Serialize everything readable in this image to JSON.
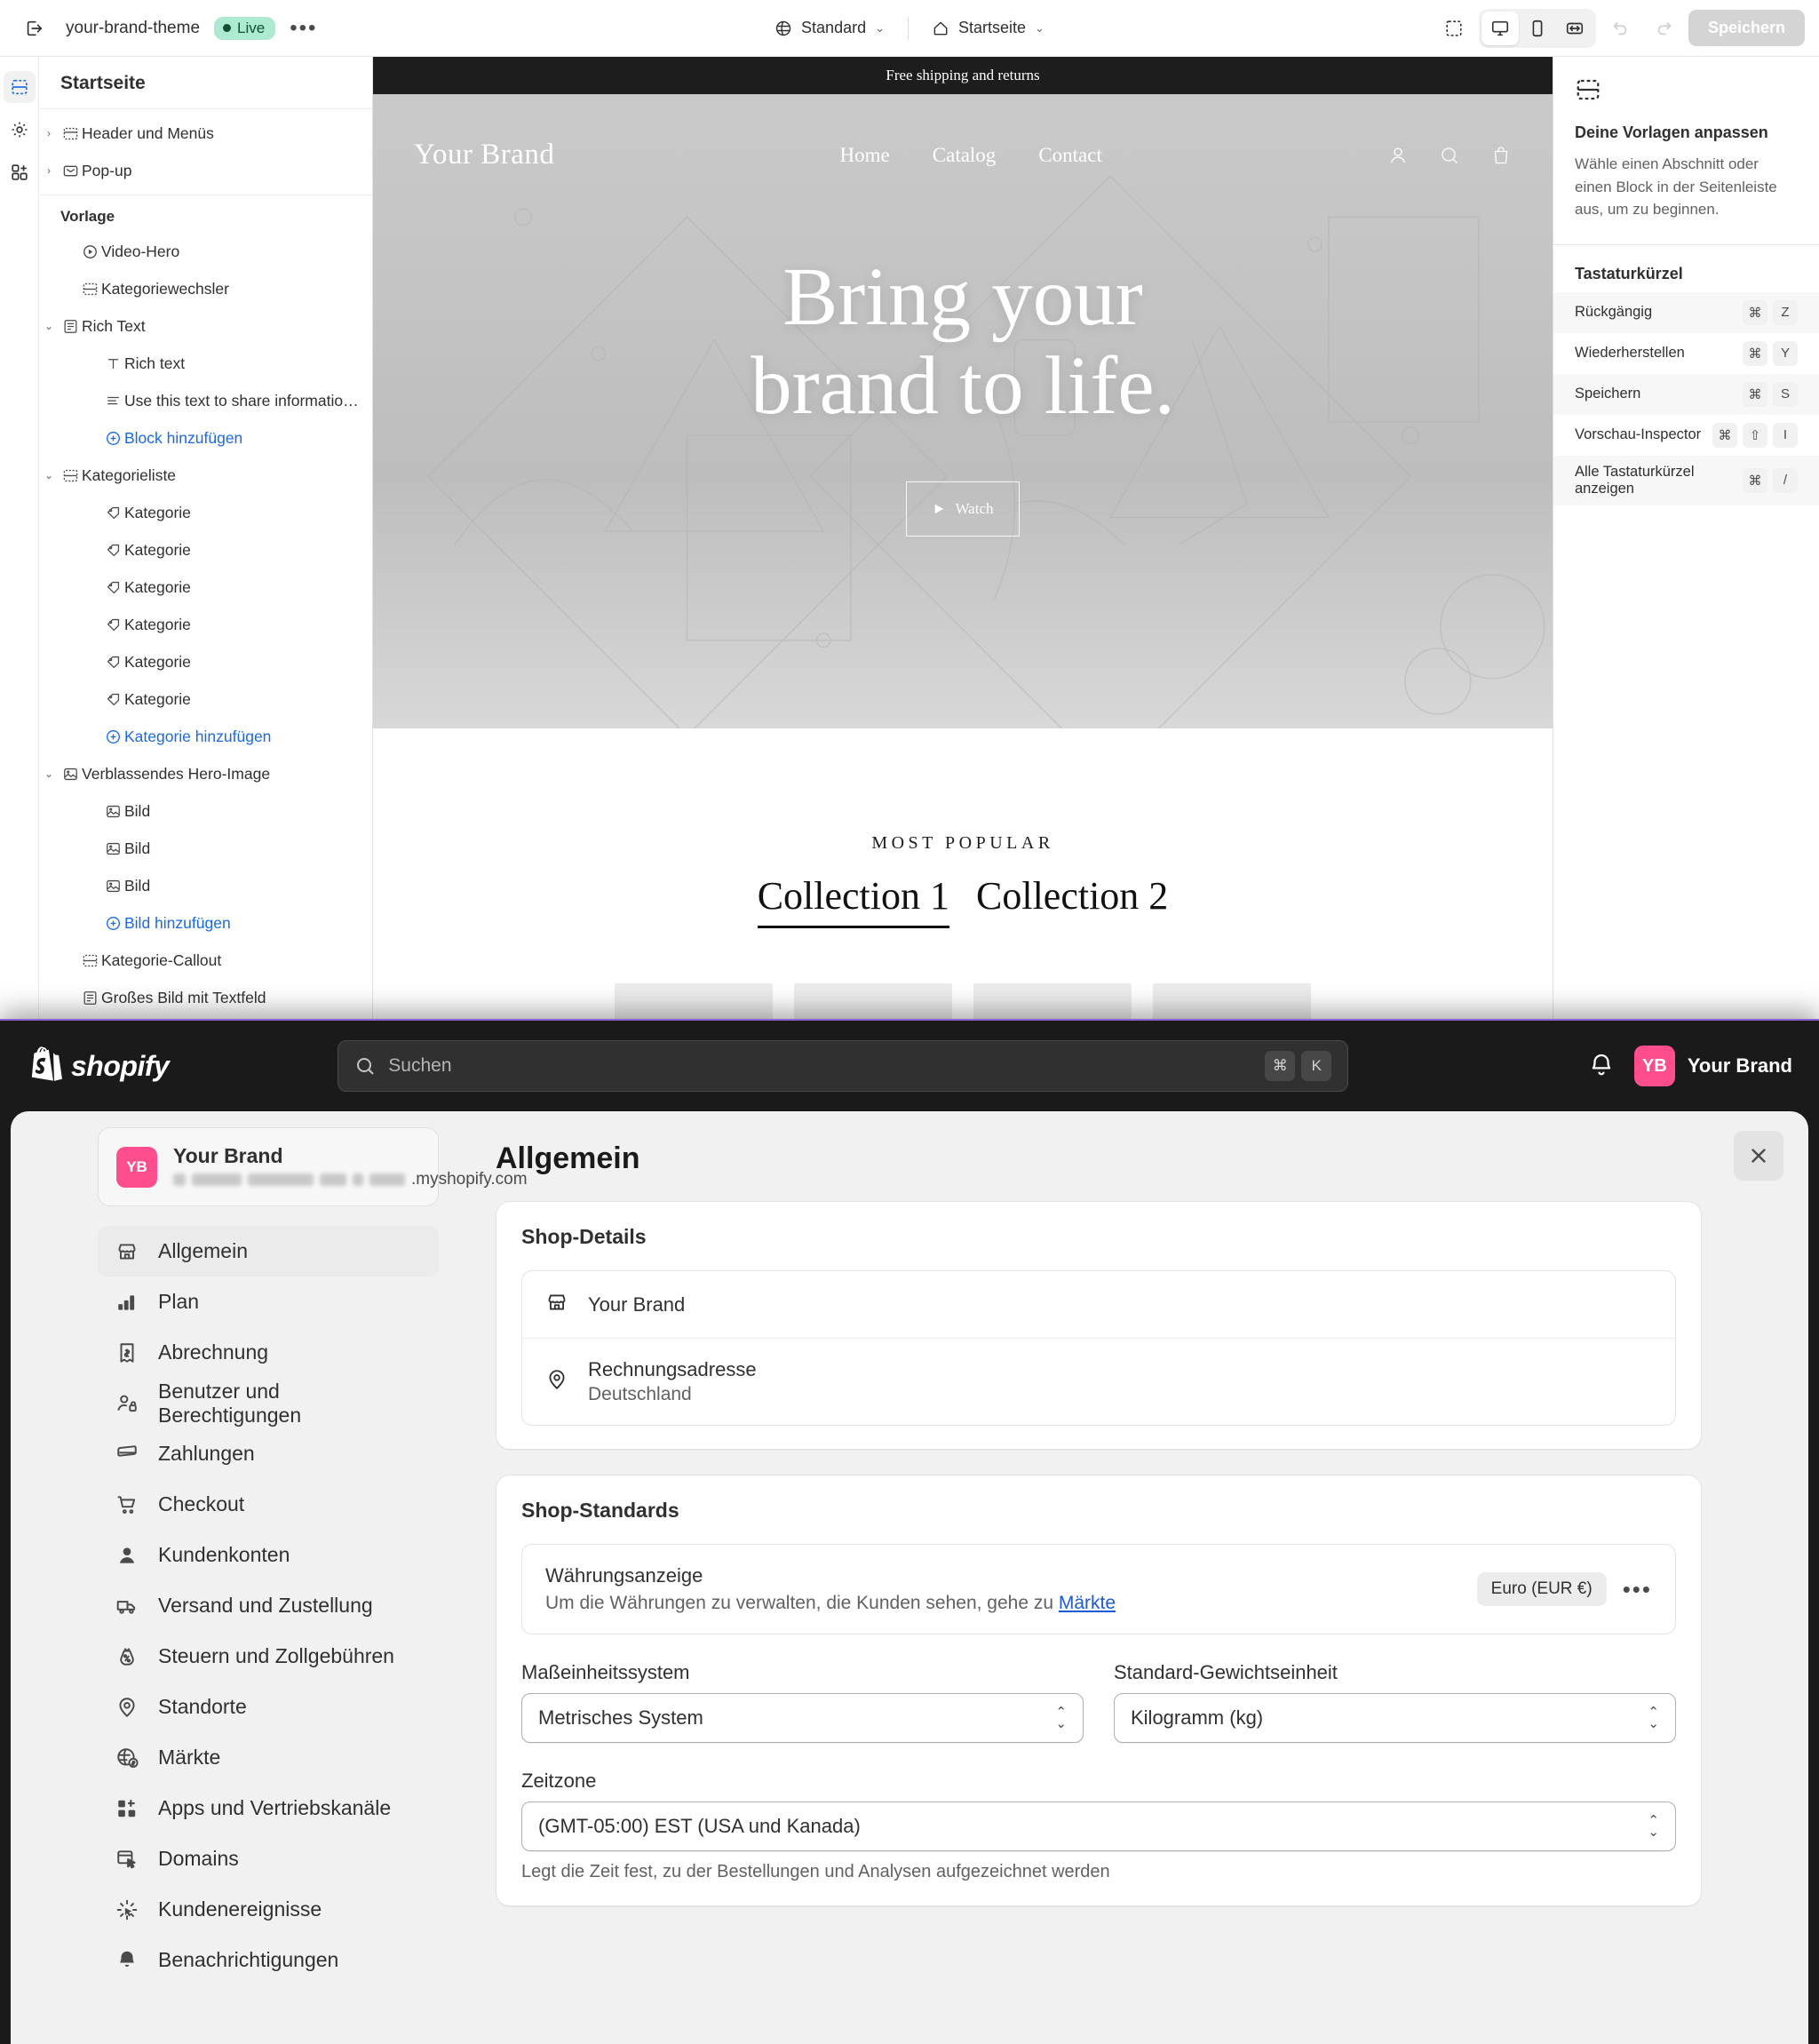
{
  "editor": {
    "topbar": {
      "exit_icon": "exit-icon",
      "theme_name": "your-brand-theme",
      "live_label": "Live",
      "more_label": "•••",
      "locale_label": "Standard",
      "page_label": "Startseite",
      "inspector_icon": "selection-inspector-icon",
      "device_desktop": "desktop-icon",
      "device_mobile": "mobile-icon",
      "device_fullwidth": "fullwidth-icon",
      "undo_icon": "undo-icon",
      "redo_icon": "redo-icon",
      "save_label": "Speichern"
    },
    "rail": [
      {
        "name": "sections-icon",
        "active": true
      },
      {
        "name": "settings-gear-icon",
        "active": false
      },
      {
        "name": "apps-icon",
        "active": false
      }
    ],
    "tree": {
      "title": "Startseite",
      "group_label": "Vorlage",
      "top_items": [
        {
          "label": "Header und Menüs",
          "icon": "header-icon",
          "caret": "›"
        },
        {
          "label": "Pop-up",
          "icon": "popup-icon",
          "caret": "›"
        }
      ],
      "items": [
        {
          "label": "Video-Hero",
          "icon": "video-icon",
          "indent": 1,
          "caret": ""
        },
        {
          "label": "Kategoriewechsler",
          "icon": "section-icon",
          "indent": 1,
          "caret": ""
        },
        {
          "label": "Rich Text",
          "icon": "richtext-icon",
          "indent": 0,
          "caret": "⌄"
        },
        {
          "label": "Rich text",
          "icon": "text-T-icon",
          "indent": 2,
          "caret": ""
        },
        {
          "label": "Use this text to share information...",
          "icon": "paragraph-icon",
          "indent": 2,
          "caret": ""
        },
        {
          "label": "Block hinzufügen",
          "icon": "plus-circle-icon",
          "indent": 2,
          "caret": "",
          "add": true
        },
        {
          "label": "Kategorieliste",
          "icon": "section-icon",
          "indent": 0,
          "caret": "⌄"
        },
        {
          "label": "Kategorie",
          "icon": "tag-icon",
          "indent": 2,
          "caret": ""
        },
        {
          "label": "Kategorie",
          "icon": "tag-icon",
          "indent": 2,
          "caret": ""
        },
        {
          "label": "Kategorie",
          "icon": "tag-icon",
          "indent": 2,
          "caret": ""
        },
        {
          "label": "Kategorie",
          "icon": "tag-icon",
          "indent": 2,
          "caret": ""
        },
        {
          "label": "Kategorie",
          "icon": "tag-icon",
          "indent": 2,
          "caret": ""
        },
        {
          "label": "Kategorie",
          "icon": "tag-icon",
          "indent": 2,
          "caret": ""
        },
        {
          "label": "Kategorie hinzufügen",
          "icon": "plus-circle-icon",
          "indent": 2,
          "caret": "",
          "add": true
        },
        {
          "label": "Verblassendes Hero-Image",
          "icon": "image-icon",
          "indent": 0,
          "caret": "⌄"
        },
        {
          "label": "Bild",
          "icon": "image-icon",
          "indent": 2,
          "caret": ""
        },
        {
          "label": "Bild",
          "icon": "image-icon",
          "indent": 2,
          "caret": ""
        },
        {
          "label": "Bild",
          "icon": "image-icon",
          "indent": 2,
          "caret": ""
        },
        {
          "label": "Bild hinzufügen",
          "icon": "plus-circle-icon",
          "indent": 2,
          "caret": "",
          "add": true
        },
        {
          "label": "Kategorie-Callout",
          "icon": "section-icon",
          "indent": 1,
          "caret": ""
        },
        {
          "label": "Großes Bild mit Textfeld",
          "icon": "richtext-icon",
          "indent": 1,
          "caret": ""
        }
      ]
    },
    "preview": {
      "announcement": "Free shipping and returns",
      "brand": "Your Brand",
      "nav": [
        "Home",
        "Catalog",
        "Contact"
      ],
      "icons": [
        "account-icon",
        "search-icon",
        "cart-icon"
      ],
      "headline_line1": "Bring your",
      "headline_line2": "brand to life.",
      "watch_label": "Watch",
      "eyebrow": "MOST POPULAR",
      "collections": [
        "Collection 1",
        "Collection 2"
      ],
      "selected_collection": "Collection 1"
    },
    "inspector": {
      "icon": "section-icon",
      "heading": "Deine Vorlagen anpassen",
      "body": "Wähle einen Abschnitt oder einen Block in der Seitenleiste aus, um zu beginnen.",
      "shortcuts_heading": "Tastaturkürzel",
      "shortcuts": [
        {
          "label": "Rückgängig",
          "keys": [
            "⌘",
            "Z"
          ]
        },
        {
          "label": "Wiederherstellen",
          "keys": [
            "⌘",
            "Y"
          ]
        },
        {
          "label": "Speichern",
          "keys": [
            "⌘",
            "S"
          ]
        },
        {
          "label": "Vorschau-Inspector",
          "keys": [
            "⌘",
            "⇧",
            "I"
          ]
        },
        {
          "label": "Alle Tastaturkürzel anzeigen",
          "keys": [
            "⌘",
            "/"
          ]
        }
      ]
    }
  },
  "admin": {
    "logo_text": "shopify",
    "search_placeholder": "Suchen",
    "search_keys": [
      "⌘",
      "K"
    ],
    "notification_icon": "bell-icon",
    "store_initials": "YB",
    "store_name": "Your Brand"
  },
  "settings": {
    "close_icon": "close-icon",
    "brand": {
      "initials": "YB",
      "name": "Your Brand",
      "url_suffix": ".myshopify.com"
    },
    "nav": [
      {
        "label": "Allgemein",
        "icon": "store-icon",
        "active": true
      },
      {
        "label": "Plan",
        "icon": "plan-chart-icon",
        "active": false
      },
      {
        "label": "Abrechnung",
        "icon": "billing-receipt-icon",
        "active": false
      },
      {
        "label": "Benutzer und Berechtigungen",
        "icon": "users-permissions-icon",
        "active": false
      },
      {
        "label": "Zahlungen",
        "icon": "payments-card-icon",
        "active": false
      },
      {
        "label": "Checkout",
        "icon": "cart-icon",
        "active": false
      },
      {
        "label": "Kundenkonten",
        "icon": "person-icon",
        "active": false
      },
      {
        "label": "Versand und Zustellung",
        "icon": "truck-icon",
        "active": false
      },
      {
        "label": "Steuern und Zollgebühren",
        "icon": "tax-bag-icon",
        "active": false
      },
      {
        "label": "Standorte",
        "icon": "location-pin-icon",
        "active": false
      },
      {
        "label": "Märkte",
        "icon": "globe-dollar-icon",
        "active": false
      },
      {
        "label": "Apps und Vertriebskanäle",
        "icon": "apps-grid-plus-icon",
        "active": false
      },
      {
        "label": "Domains",
        "icon": "domains-icon",
        "active": false
      },
      {
        "label": "Kundenereignisse",
        "icon": "customer-events-icon",
        "active": false
      },
      {
        "label": "Benachrichtigungen",
        "icon": "bell-icon",
        "active": false
      }
    ],
    "page_title": "Allgemein",
    "shop_details": {
      "heading": "Shop-Details",
      "store_name": "Your Brand",
      "store_icon": "store-icon",
      "address_label": "Rechnungsadresse",
      "address_value": "Deutschland",
      "address_icon": "location-pin-icon"
    },
    "shop_defaults": {
      "heading": "Shop-Standards",
      "currency_title": "Währungsanzeige",
      "currency_desc_pre": "Um die Währungen zu verwalten, die Kunden sehen, gehe zu ",
      "currency_link": "Märkte",
      "currency_badge": "Euro (EUR €)",
      "currency_more": "•••",
      "unit_label": "Maßeinheitssystem",
      "unit_value": "Metrisches System",
      "weight_label": "Standard-Gewichtseinheit",
      "weight_value": "Kilogramm (kg)",
      "timezone_label": "Zeitzone",
      "timezone_value": "(GMT-05:00) EST (USA und Kanada)",
      "timezone_help": "Legt die Zeit fest, zu der Bestellungen und Analysen aufgezeichnet werden"
    }
  }
}
